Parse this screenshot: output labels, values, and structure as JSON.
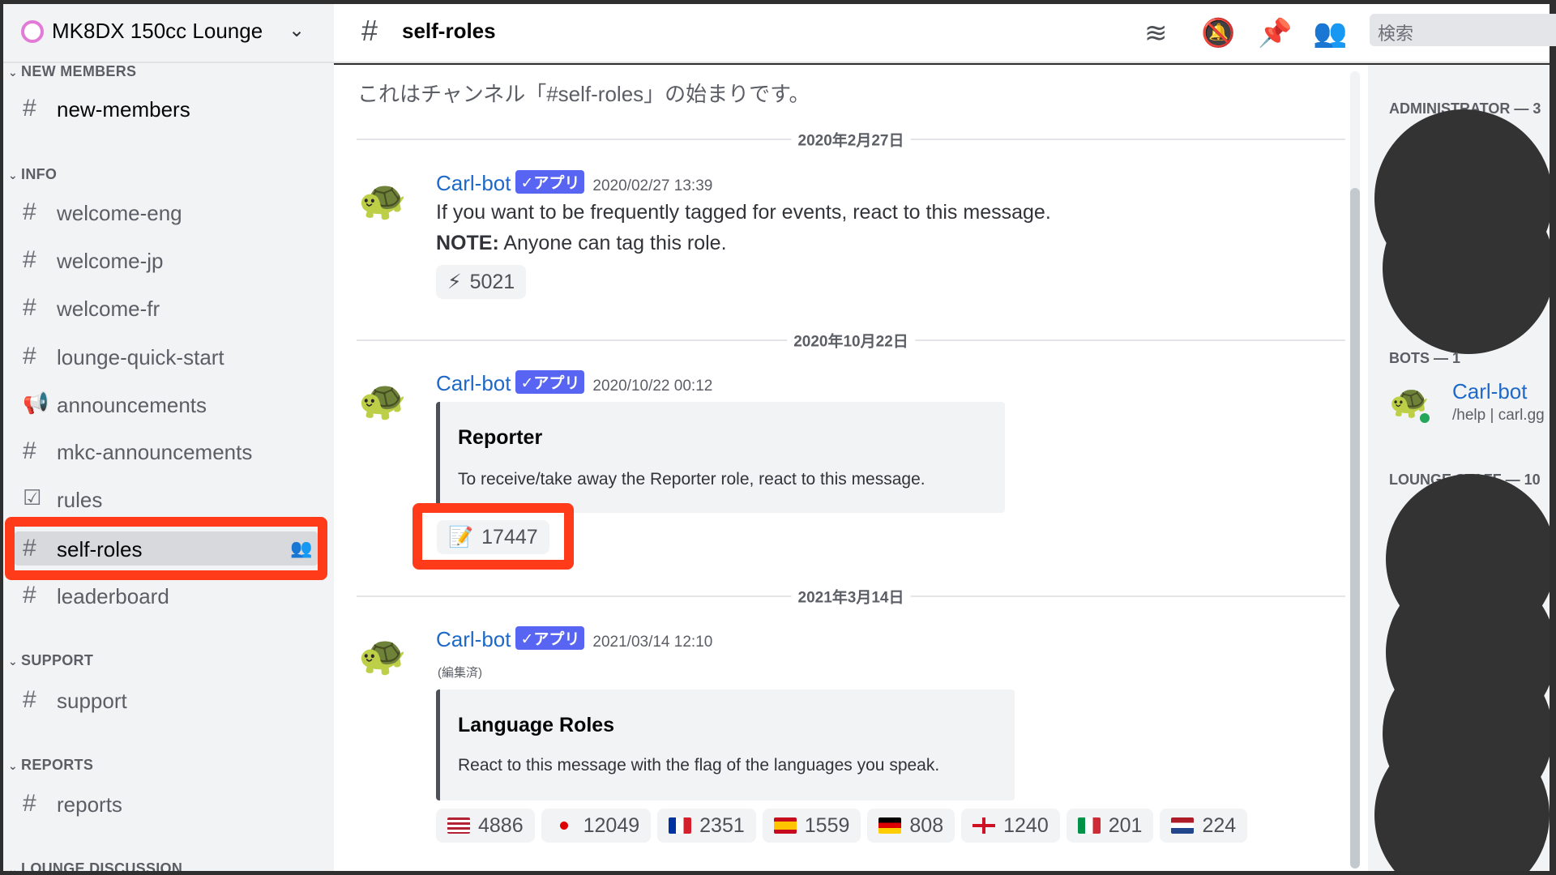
{
  "server": {
    "name": "MK8DX 150cc Lounge"
  },
  "channel_header": {
    "name": "self-roles",
    "search_placeholder": "検索",
    "icons": [
      "threads-icon",
      "mute-bell-icon",
      "pin-icon",
      "members-icon"
    ]
  },
  "sidebar": {
    "categories": [
      "NEW MEMBERS",
      "INFO",
      "SUPPORT",
      "REPORTS",
      "LOUNGE DISCUSSION"
    ],
    "channels": [
      {
        "label": "new-members",
        "icon": "hash"
      },
      {
        "label": "welcome-eng",
        "icon": "hash"
      },
      {
        "label": "welcome-jp",
        "icon": "hash"
      },
      {
        "label": "welcome-fr",
        "icon": "hash"
      },
      {
        "label": "lounge-quick-start",
        "icon": "hash-lock"
      },
      {
        "label": "announcements",
        "icon": "megaphone"
      },
      {
        "label": "mkc-announcements",
        "icon": "hash"
      },
      {
        "label": "rules",
        "icon": "rules-checkbox"
      },
      {
        "label": "self-roles",
        "icon": "hash-lock",
        "selected": true
      },
      {
        "label": "leaderboard",
        "icon": "hash"
      },
      {
        "label": "support",
        "icon": "hash-lock"
      },
      {
        "label": "reports",
        "icon": "hash-lock"
      }
    ]
  },
  "main": {
    "intro": "これはチャンネル「#self-roles」の始まりです。",
    "messages": [
      {
        "date": "2020年2月27日",
        "author": "Carl-bot",
        "badge": "✓アプリ",
        "timestamp": "2020/02/27 13:39",
        "line1": "If you want to be frequently tagged for events, react to this message.",
        "note_label": "NOTE:",
        "note_text": " Anyone can tag this role.",
        "reactions": [
          {
            "emoji": "⚡",
            "count": "5021"
          }
        ]
      },
      {
        "date": "2020年10月22日",
        "author": "Carl-bot",
        "badge": "✓アプリ",
        "timestamp": "2020/10/22 00:12",
        "embed_title": "Reporter",
        "embed_desc": "To receive/take away the Reporter role, react to this message.",
        "reactions": [
          {
            "emoji": "📝",
            "count": "17447"
          }
        ]
      },
      {
        "date": "2021年3月14日",
        "author": "Carl-bot",
        "badge": "✓アプリ",
        "timestamp": "2021/03/14 12:10",
        "edited": "(編集済)",
        "embed_title": "Language Roles",
        "embed_desc": "React to this message with the flag of the languages you speak.",
        "reactions": [
          {
            "emoji": "flag-us",
            "count": "4886"
          },
          {
            "emoji": "flag-jp",
            "count": "12049"
          },
          {
            "emoji": "flag-fr",
            "count": "2351"
          },
          {
            "emoji": "flag-es",
            "count": "1559"
          },
          {
            "emoji": "flag-de",
            "count": "808"
          },
          {
            "emoji": "flag-england",
            "count": "1240"
          },
          {
            "emoji": "flag-it",
            "count": "201"
          },
          {
            "emoji": "flag-nl",
            "count": "224"
          }
        ]
      }
    ]
  },
  "members": {
    "groups": [
      {
        "label": "ADMINISTRATOR — 3"
      },
      {
        "label": "BOTS — 1"
      },
      {
        "label": "LOUNGE STAFF — 10"
      }
    ],
    "bot": {
      "name": "Carl-bot",
      "status": "/help | carl.gg"
    }
  },
  "colors": {
    "highlight": "#ff3b1a",
    "accent": "#5865f2",
    "link": "#1e69c8",
    "online": "#23a55a"
  }
}
